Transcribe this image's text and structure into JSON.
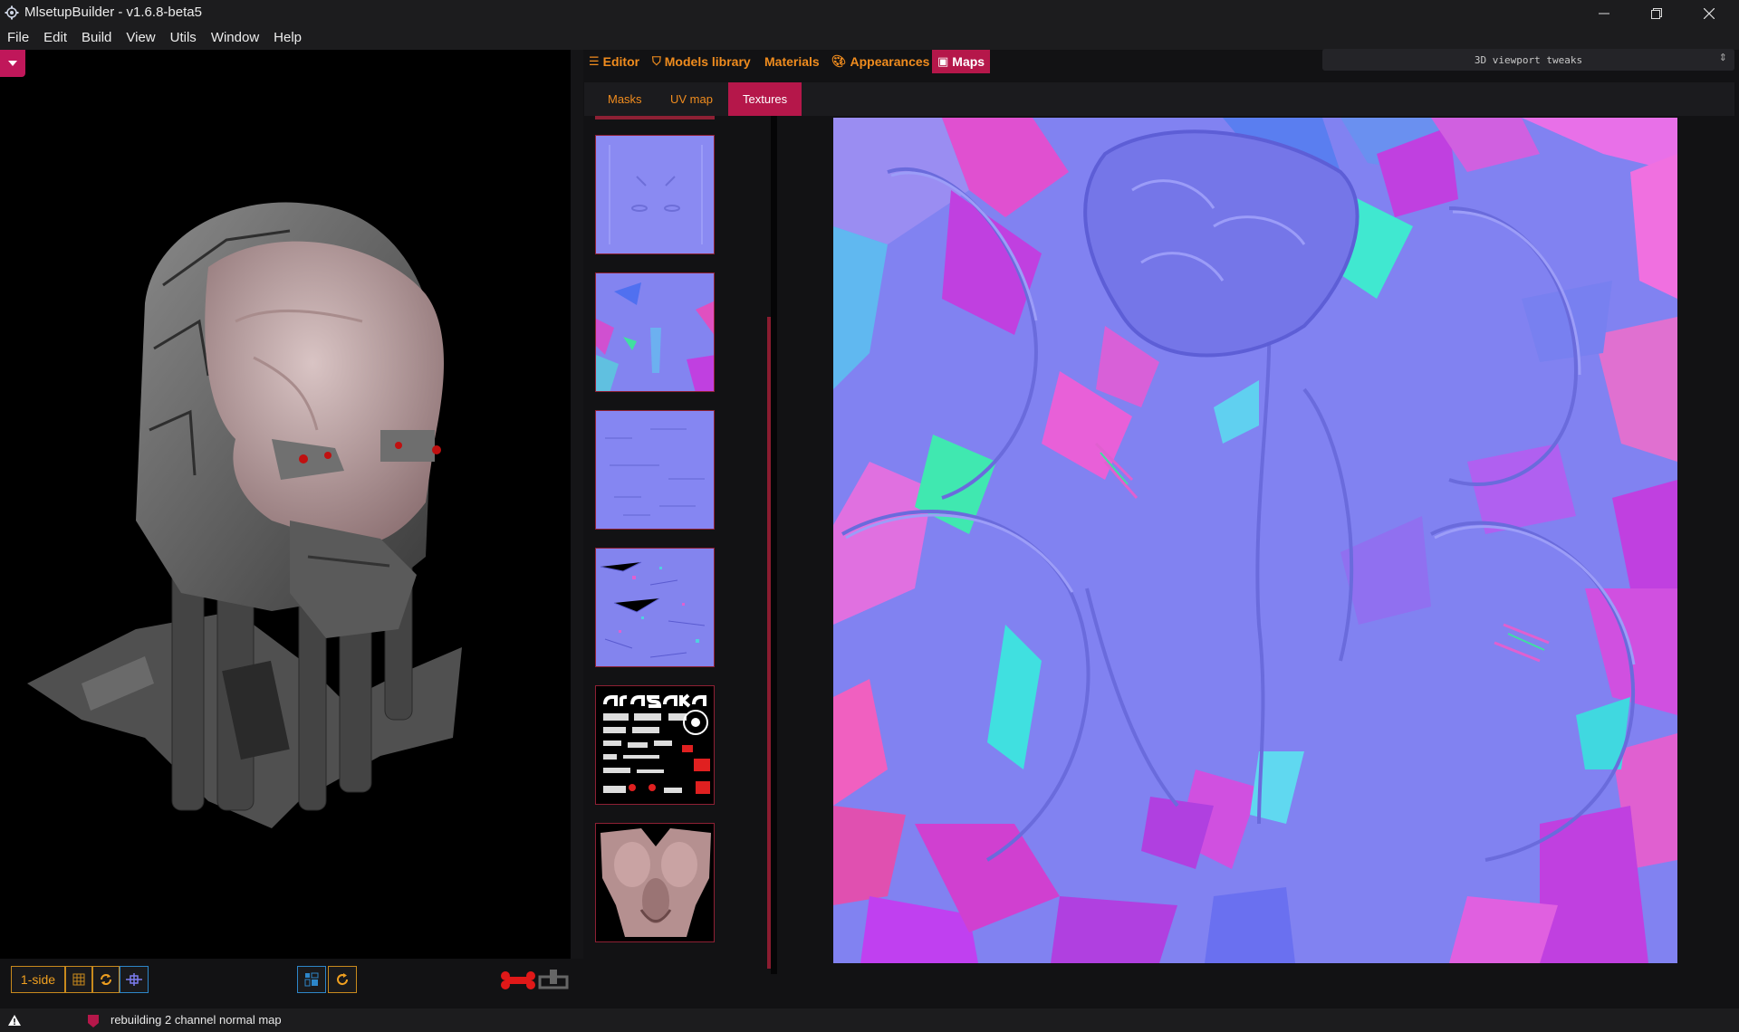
{
  "window": {
    "title": "MlsetupBuilder - v1.6.8-beta5"
  },
  "menu": [
    "File",
    "Edit",
    "Build",
    "View",
    "Utils",
    "Window",
    "Help"
  ],
  "viewport": {
    "side_button": "1-side"
  },
  "tabs": [
    {
      "label": "Editor",
      "icon": "bars-icon",
      "active": false
    },
    {
      "label": "Models library",
      "icon": "shield-icon",
      "active": false
    },
    {
      "label": "Materials",
      "icon": "",
      "active": false
    },
    {
      "label": "Appearances",
      "icon": "palette-icon",
      "active": false
    },
    {
      "label": "Maps",
      "icon": "image-icon",
      "active": true
    }
  ],
  "tweaks": {
    "label": "3D viewport tweaks"
  },
  "subtabs": [
    {
      "label": "Masks",
      "active": false
    },
    {
      "label": "UV map",
      "active": false
    },
    {
      "label": "Textures",
      "active": true
    }
  ],
  "thumbnails": [
    {
      "kind": "normal-map-slots"
    },
    {
      "kind": "normal-map-face"
    },
    {
      "kind": "normal-map-details"
    },
    {
      "kind": "normal-map-noise"
    },
    {
      "kind": "decal-sheet",
      "logo": "arasaka"
    },
    {
      "kind": "diffuse-skin"
    }
  ],
  "status": {
    "message": "rebuilding 2 channel normal map"
  },
  "colors": {
    "accent": "#b5174a",
    "orange": "#f08c1e",
    "blue": "#2d86c9",
    "normal_base": "#7f80f0"
  }
}
